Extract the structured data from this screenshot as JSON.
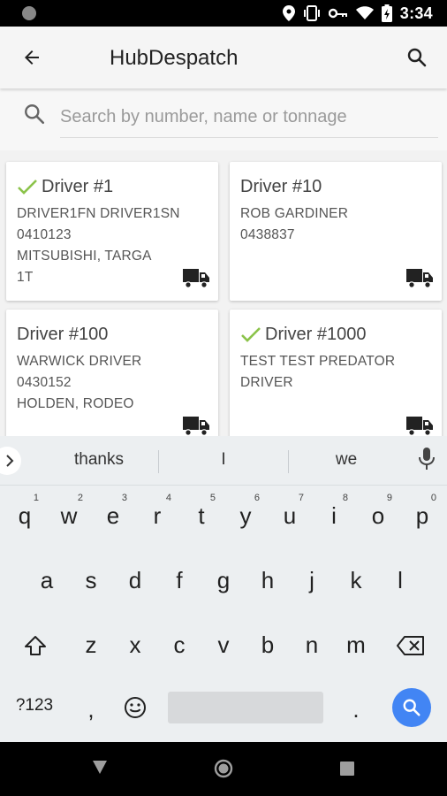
{
  "status": {
    "time": "3:34"
  },
  "app": {
    "title": "HubDespatch"
  },
  "search": {
    "placeholder": "Search by number, name or tonnage",
    "value": ""
  },
  "drivers": [
    {
      "title": "Driver #1",
      "checked": true,
      "lines": [
        "DRIVER1FN DRIVER1SN",
        "0410123",
        "MITSUBISHI, TARGA",
        "1T"
      ],
      "truck": true
    },
    {
      "title": "Driver #10",
      "checked": false,
      "lines": [
        "ROB GARDINER",
        "0438837"
      ],
      "truck": true
    },
    {
      "title": "Driver #100",
      "checked": false,
      "lines": [
        "WARWICK DRIVER",
        "0430152",
        "HOLDEN, RODEO"
      ],
      "truck": true
    },
    {
      "title": "Driver #1000",
      "checked": true,
      "lines": [
        "TEST TEST PREDATOR",
        "DRIVER"
      ],
      "truck": true
    }
  ],
  "keyboard": {
    "suggestions": [
      "thanks",
      "I",
      "we"
    ],
    "row1": [
      "q",
      "w",
      "e",
      "r",
      "t",
      "y",
      "u",
      "i",
      "o",
      "p"
    ],
    "row1_sup": [
      "1",
      "2",
      "3",
      "4",
      "5",
      "6",
      "7",
      "8",
      "9",
      "0"
    ],
    "row2": [
      "a",
      "s",
      "d",
      "f",
      "g",
      "h",
      "j",
      "k",
      "l"
    ],
    "row3": [
      "z",
      "x",
      "c",
      "v",
      "b",
      "n",
      "m"
    ],
    "symbols_label": "?123",
    "comma": ",",
    "period": "."
  },
  "colors": {
    "check": "#8bc34a",
    "accent": "#4285f4"
  }
}
